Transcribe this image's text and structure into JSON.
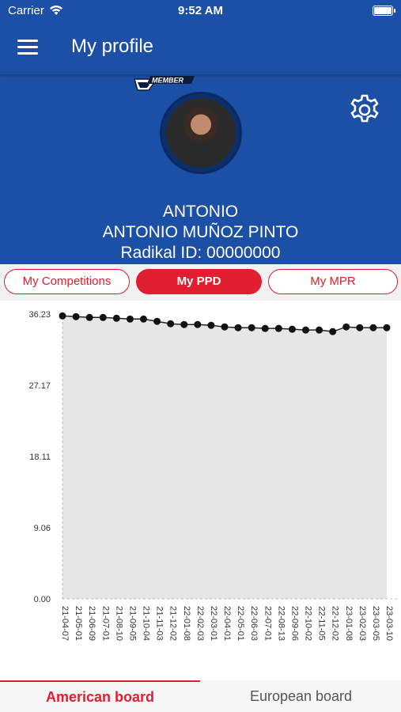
{
  "status_bar": {
    "carrier": "Carrier",
    "time": "9:52 AM"
  },
  "nav": {
    "title": "My profile",
    "menu_icon": "hamburger-menu-icon"
  },
  "profile": {
    "badge": "MEMBER",
    "first_name": "ANTONIO",
    "full_name": "ANTONIO MUÑOZ PINTO",
    "radikal_id": "Radikal ID: 00000000",
    "settings_icon": "gear-icon"
  },
  "tabs": {
    "competitions": "My Competitions",
    "ppd": "My PPD",
    "mpr": "My MPR",
    "active": "ppd"
  },
  "colors": {
    "primary_blue": "#1c4fa6",
    "accent_red": "#e01e2f",
    "fill_gray": "#e6e6e6"
  },
  "chart_data": {
    "type": "area",
    "title": "",
    "xlabel": "",
    "ylabel": "",
    "ylim": [
      0,
      36.23
    ],
    "y_ticks": [
      "36.23",
      "27.17",
      "18.11",
      "9.06",
      "0.00"
    ],
    "grid": false,
    "x": [
      "21-04-07",
      "21-05-01",
      "21-06-09",
      "21-07-01",
      "21-08-10",
      "21-09-05",
      "21-10-04",
      "21-11-03",
      "21-12-02",
      "22-01-08",
      "22-02-03",
      "22-03-01",
      "22-04-01",
      "22-05-01",
      "22-06-03",
      "22-07-01",
      "22-08-13",
      "22-09-06",
      "22-10-02",
      "22-11-05",
      "22-12-02",
      "23-01-08",
      "23-02-03",
      "23-03-05",
      "23-03-10"
    ],
    "series": [
      {
        "values": [
          36.0,
          35.9,
          35.8,
          35.8,
          35.7,
          35.6,
          35.6,
          35.3,
          35.0,
          34.9,
          34.9,
          34.8,
          34.6,
          34.5,
          34.5,
          34.4,
          34.4,
          34.3,
          34.2,
          34.2,
          34.0,
          34.6,
          34.5,
          34.5,
          34.5
        ]
      }
    ]
  },
  "bottom_tabs": {
    "american": "American board",
    "european": "European board",
    "active": "american"
  }
}
